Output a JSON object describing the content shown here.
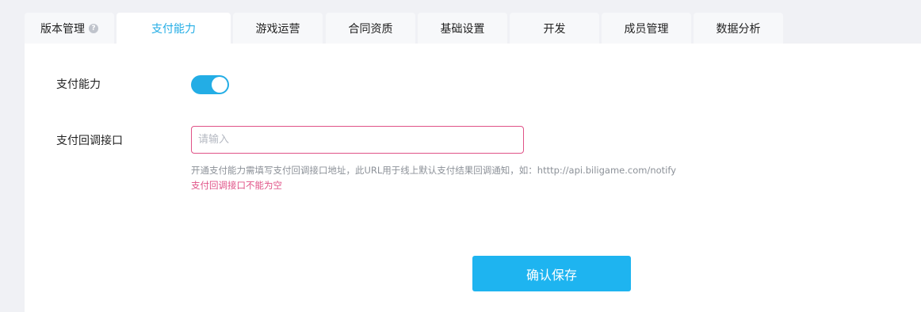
{
  "tabs": [
    {
      "label": "版本管理",
      "has_help": true,
      "active": false
    },
    {
      "label": "支付能力",
      "active": true
    },
    {
      "label": "游戏运营",
      "active": false
    },
    {
      "label": "合同资质",
      "active": false
    },
    {
      "label": "基础设置",
      "active": false
    },
    {
      "label": "开发",
      "active": false
    },
    {
      "label": "成员管理",
      "active": false
    },
    {
      "label": "数据分析",
      "active": false
    }
  ],
  "help_icon_glyph": "?",
  "form": {
    "payment_label": "支付能力",
    "payment_enabled": true,
    "callback_label": "支付回调接口",
    "callback_placeholder": "请输入",
    "callback_value": "",
    "callback_hint": "开通支付能力需填写支付回调接口地址，此URL用于线上默认支付结果回调通知，如：htttp://api.biligame.com/notify",
    "callback_error": "支付回调接口不能为空",
    "save_label": "确认保存"
  },
  "colors": {
    "accent": "#23ade5",
    "button": "#1eb4f0",
    "error": "#e05287",
    "background": "#f0f1f5"
  }
}
